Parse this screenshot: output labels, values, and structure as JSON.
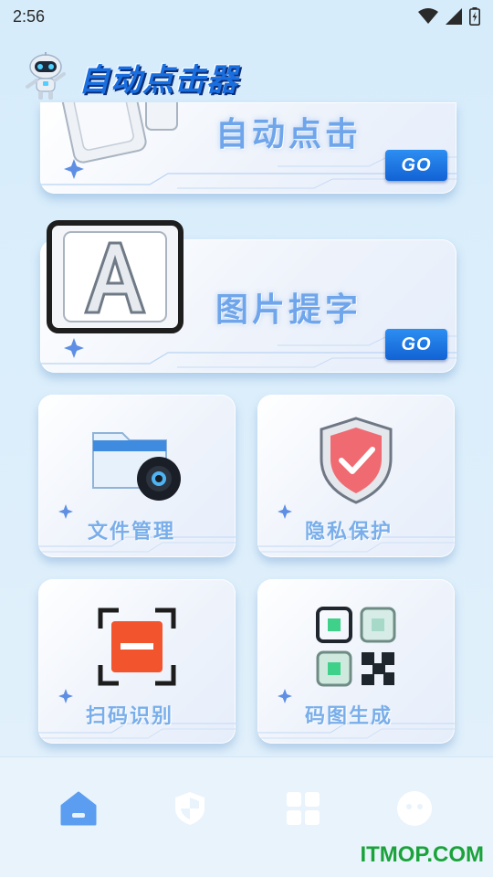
{
  "status_bar": {
    "time": "2:56"
  },
  "header": {
    "title": "自动点击器"
  },
  "banners": [
    {
      "label": "自动点击",
      "go": "GO"
    },
    {
      "label": "图片提字",
      "go": "GO"
    }
  ],
  "tiles": [
    {
      "label": "文件管理",
      "icon": "folder-gear-icon"
    },
    {
      "label": "隐私保护",
      "icon": "shield-check-icon"
    },
    {
      "label": "扫码识别",
      "icon": "scan-icon"
    },
    {
      "label": "码图生成",
      "icon": "qr-code-icon"
    }
  ],
  "bottom_nav": [
    {
      "name": "home",
      "icon": "home-icon",
      "active": true
    },
    {
      "name": "security",
      "icon": "shield-icon",
      "active": false
    },
    {
      "name": "apps",
      "icon": "grid-icon",
      "active": false
    },
    {
      "name": "profile",
      "icon": "face-icon",
      "active": false
    }
  ],
  "colors": {
    "accent": "#1a6fe0",
    "active_nav": "#5b9df0",
    "inactive_nav": "#ffffff",
    "watermark": "#1aa33a"
  },
  "watermark": "ITMOP.COM"
}
